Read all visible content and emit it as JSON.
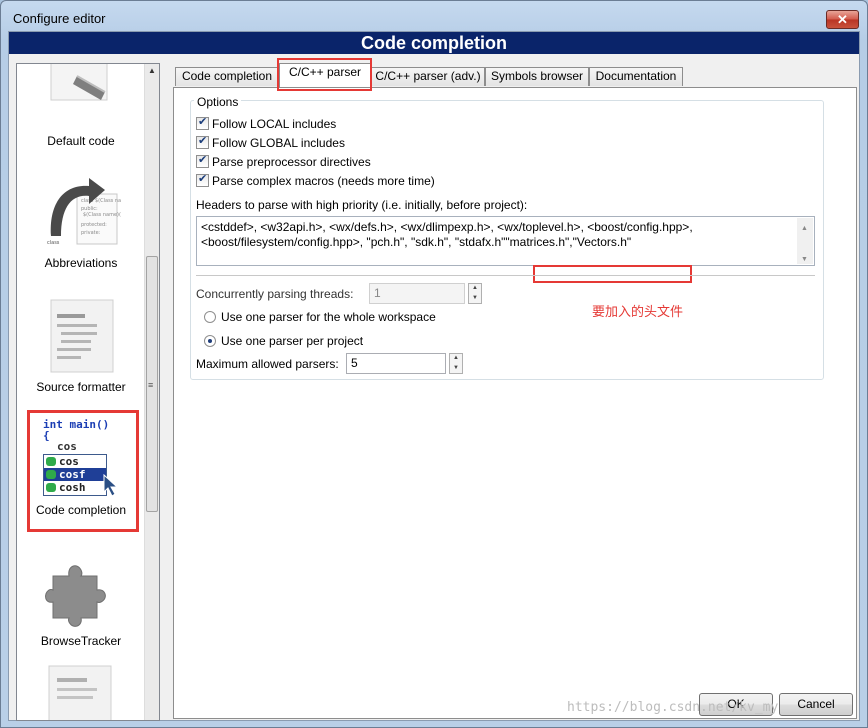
{
  "window": {
    "title": "Configure editor",
    "close_glyph": "✕"
  },
  "header": {
    "title": "Code completion"
  },
  "sidebar": {
    "items": [
      {
        "label": "Default code",
        "icon": "default-code-icon"
      },
      {
        "label": "Abbreviations",
        "icon": "abbreviations-icon"
      },
      {
        "label": "Source formatter",
        "icon": "source-formatter-icon"
      },
      {
        "label": "Code completion",
        "icon": "code-completion-icon",
        "selected": true,
        "icon_text": {
          "line1": "int main()",
          "line2": "{",
          "line3": "cos",
          "options": [
            "cos",
            "cosf",
            "cosh"
          ]
        }
      },
      {
        "label": "BrowseTracker",
        "icon": "puzzle-piece-icon"
      }
    ]
  },
  "tabs": [
    {
      "label": "Code completion"
    },
    {
      "label": "C/C++ parser",
      "active": true
    },
    {
      "label": "C/C++ parser (adv.)"
    },
    {
      "label": "Symbols browser"
    },
    {
      "label": "Documentation"
    }
  ],
  "options": {
    "legend": "Options",
    "checkboxes": [
      {
        "label": "Follow LOCAL includes",
        "checked": true
      },
      {
        "label": "Follow GLOBAL includes",
        "checked": true
      },
      {
        "label": "Parse preprocessor directives",
        "checked": true
      },
      {
        "label": "Parse complex macros (needs more time)",
        "checked": true
      }
    ],
    "headers_label": "Headers to parse with high priority (i.e. initially, before project):",
    "headers_line1": "<cstddef>, <w32api.h>, <wx/defs.h>, <wx/dlimpexp.h>, <wx/toplevel.h>, <boost/config.hpp>,",
    "headers_line2": "<boost/filesystem/config.hpp>, \"pch.h\", \"sdk.h\", \"stdafx.h\"",
    "headers_added": "\"matrices.h\",\"Vectors.h\"",
    "threads_label": "Concurrently parsing threads:",
    "threads_value": "1",
    "radio_workspace": "Use one parser for the whole workspace",
    "radio_project": "Use one parser per project",
    "max_parsers_label": "Maximum allowed parsers:",
    "max_parsers_value": "5"
  },
  "annotation": "要加入的头文件",
  "buttons": {
    "ok": "OK",
    "cancel": "Cancel"
  },
  "watermark": "https://blog.csdn.net/kv_my",
  "colors": {
    "banner": "#0a246a",
    "highlight": "#e53935"
  }
}
